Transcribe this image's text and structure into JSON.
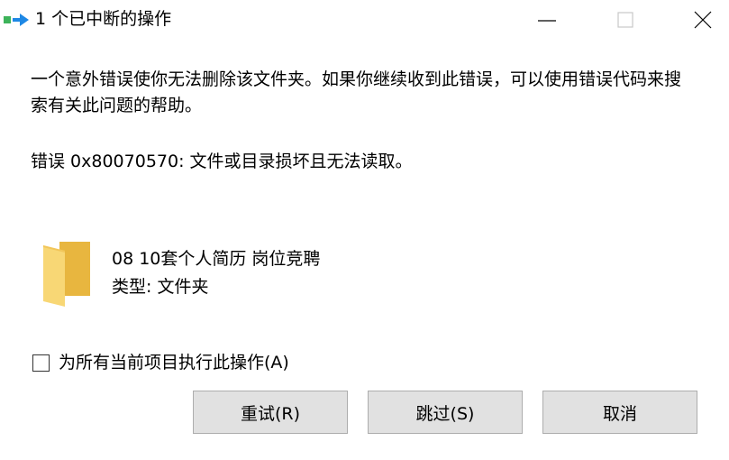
{
  "window": {
    "title": "1 个已中断的操作"
  },
  "dialog": {
    "message": "一个意外错误使你无法删除该文件夹。如果你继续收到此错误，可以使用错误代码来搜索有关此问题的帮助。",
    "error": "错误 0x80070570: 文件或目录损坏且无法读取。"
  },
  "item": {
    "name": "08 10套个人简历 岗位竞聘",
    "type": "类型: 文件夹",
    "icon": "folder-icon"
  },
  "apply_all": {
    "label": "为所有当前项目执行此操作(A)",
    "checked": false
  },
  "buttons": {
    "retry": "重试(R)",
    "skip": "跳过(S)",
    "cancel": "取消"
  },
  "colors": {
    "folder_front": "#F8D775",
    "folder_back": "#E8B63F",
    "icon_green": "#3DB35A",
    "icon_blue": "#1E88E5",
    "button_face": "#E1E1E1",
    "button_border": "#ADADAD"
  }
}
